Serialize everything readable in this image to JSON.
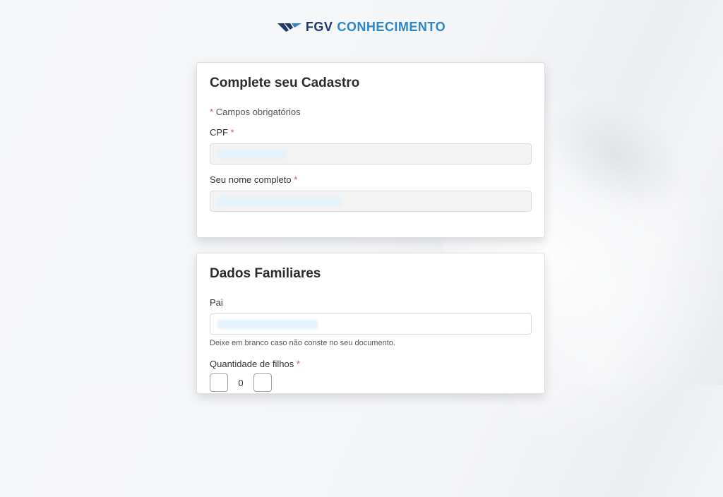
{
  "brand": {
    "part1": "FGV",
    "part2": "CONHECIMENTO",
    "colors": {
      "navy": "#1f3a66",
      "blue": "#2d86c6"
    }
  },
  "card1": {
    "title": "Complete seu Cadastro",
    "required_note_star": "*",
    "required_note": "Campos obrigatórios",
    "cpf_label": "CPF",
    "cpf_star": "*",
    "name_label": "Seu nome completo",
    "name_star": "*"
  },
  "card2": {
    "title": "Dados Familiares",
    "father_label": "Pai",
    "father_hint": "Deixe em branco caso não conste no seu documento.",
    "children_label": "Quantidade de filhos",
    "children_star": "*",
    "children_value": "0"
  },
  "colors": {
    "required": "#d9534f"
  }
}
